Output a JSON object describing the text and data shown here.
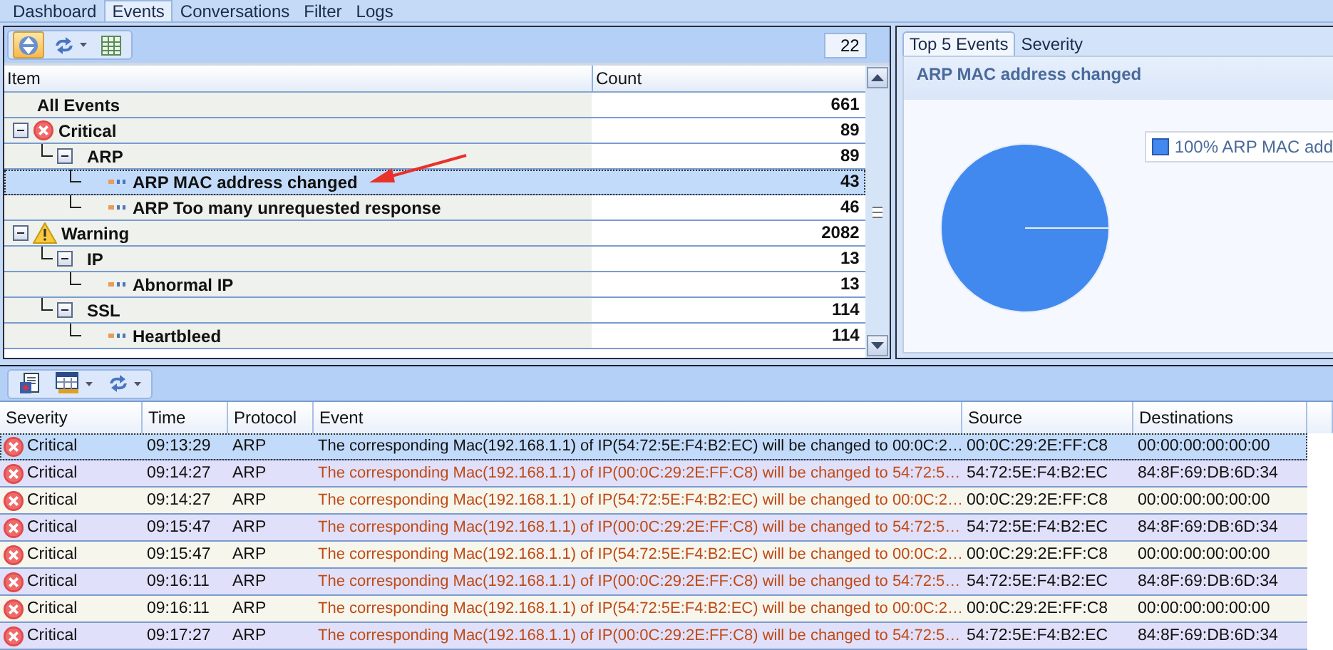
{
  "tabs": [
    {
      "label": "Dashboard",
      "selected": false
    },
    {
      "label": "Events",
      "selected": true
    },
    {
      "label": "Conversations",
      "selected": false
    },
    {
      "label": "Filter",
      "selected": false
    },
    {
      "label": "Logs",
      "selected": false
    }
  ],
  "event_tree": {
    "toolbar": [
      {
        "kind": "sort",
        "pressed": true
      },
      {
        "kind": "refresh",
        "pressed": false,
        "dropdown": true
      },
      {
        "kind": "table",
        "pressed": false
      }
    ],
    "count_field": {
      "value": "22"
    },
    "columns": [
      "Item",
      "Count"
    ],
    "nodes": [
      {
        "kind": "total",
        "label": "All Events",
        "count": "661",
        "selected": false
      },
      {
        "kind": "critical",
        "label": "Critical",
        "count": "89",
        "selected": false,
        "expanded": true,
        "children": [
          {
            "kind": "group",
            "label": "ARP",
            "count": "89",
            "selected": false,
            "expanded": true,
            "children": [
              {
                "kind": "leaf",
                "label": "ARP MAC address changed",
                "count": "43",
                "selected": true
              },
              {
                "kind": "leaf",
                "label": "ARP Too many unrequested response",
                "count": "46",
                "selected": false
              }
            ]
          }
        ]
      },
      {
        "kind": "warning",
        "label": "Warning",
        "count": "2082",
        "selected": false,
        "expanded": true,
        "children": [
          {
            "kind": "group",
            "label": "IP",
            "count": "13",
            "selected": false,
            "expanded": true,
            "children": [
              {
                "kind": "leaf",
                "label": "Abnormal IP",
                "count": "13",
                "selected": false
              }
            ]
          },
          {
            "kind": "group",
            "label": "SSL",
            "count": "114",
            "selected": false,
            "expanded": true,
            "children": [
              {
                "kind": "leaf",
                "label": "Heartbleed",
                "count": "114",
                "selected": false
              }
            ]
          }
        ]
      }
    ]
  },
  "chart_panel": {
    "tabs": [
      {
        "label": "Top 5 Events",
        "selected": true
      },
      {
        "label": "Severity",
        "selected": false
      }
    ],
    "chart_data": {
      "type": "pie",
      "title": "ARP MAC address changed",
      "series": [
        {
          "name": "100% ARP MAC add",
          "color": "#4189ee",
          "values": [
            100
          ]
        }
      ]
    }
  },
  "event_log": {
    "toolbar": [
      {
        "kind": "export"
      },
      {
        "kind": "columns",
        "dropdown": true
      },
      {
        "kind": "refresh",
        "dropdown": true
      }
    ],
    "columns": [
      "Severity",
      "Time",
      "Protocol",
      "Event",
      "Source",
      "Destinations"
    ],
    "rows": [
      {
        "severity": "Critical",
        "time": "09:13:29",
        "protocol": "ARP",
        "event": "The corresponding Mac(192.168.1.1) of IP(54:72:5E:F4:B2:EC) will be changed to 00:0C:2…",
        "source": "00:0C:29:2E:FF:C8",
        "destination": "00:00:00:00:00:00",
        "selected": true
      },
      {
        "severity": "Critical",
        "time": "09:14:27",
        "protocol": "ARP",
        "event": "The corresponding Mac(192.168.1.1) of IP(00:0C:29:2E:FF:C8) will be changed to 54:72:5…",
        "source": "54:72:5E:F4:B2:EC",
        "destination": "84:8F:69:DB:6D:34",
        "selected": false
      },
      {
        "severity": "Critical",
        "time": "09:14:27",
        "protocol": "ARP",
        "event": "The corresponding Mac(192.168.1.1) of IP(54:72:5E:F4:B2:EC) will be changed to 00:0C:2…",
        "source": "00:0C:29:2E:FF:C8",
        "destination": "00:00:00:00:00:00",
        "selected": false
      },
      {
        "severity": "Critical",
        "time": "09:15:47",
        "protocol": "ARP",
        "event": "The corresponding Mac(192.168.1.1) of IP(00:0C:29:2E:FF:C8) will be changed to 54:72:5…",
        "source": "54:72:5E:F4:B2:EC",
        "destination": "84:8F:69:DB:6D:34",
        "selected": false
      },
      {
        "severity": "Critical",
        "time": "09:15:47",
        "protocol": "ARP",
        "event": "The corresponding Mac(192.168.1.1) of IP(54:72:5E:F4:B2:EC) will be changed to 00:0C:2…",
        "source": "00:0C:29:2E:FF:C8",
        "destination": "00:00:00:00:00:00",
        "selected": false
      },
      {
        "severity": "Critical",
        "time": "09:16:11",
        "protocol": "ARP",
        "event": "The corresponding Mac(192.168.1.1) of IP(00:0C:29:2E:FF:C8) will be changed to 54:72:5…",
        "source": "54:72:5E:F4:B2:EC",
        "destination": "84:8F:69:DB:6D:34",
        "selected": false
      },
      {
        "severity": "Critical",
        "time": "09:16:11",
        "protocol": "ARP",
        "event": "The corresponding Mac(192.168.1.1) of IP(54:72:5E:F4:B2:EC) will be changed to 00:0C:2…",
        "source": "00:0C:29:2E:FF:C8",
        "destination": "00:00:00:00:00:00",
        "selected": false
      },
      {
        "severity": "Critical",
        "time": "09:17:27",
        "protocol": "ARP",
        "event": "The corresponding Mac(192.168.1.1) of IP(00:0C:29:2E:FF:C8) will be changed to 54:72:5…",
        "source": "54:72:5E:F4:B2:EC",
        "destination": "84:8F:69:DB:6D:34",
        "selected": false
      }
    ]
  }
}
